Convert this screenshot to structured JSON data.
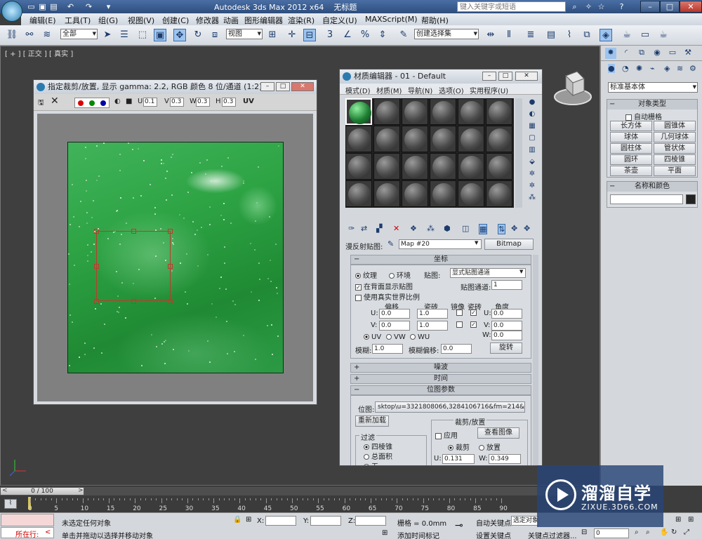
{
  "app": {
    "title": "Autodesk 3ds Max  2012 x64",
    "doc_title": "无标题",
    "search_placeholder": "键入关键字或短语"
  },
  "menu": [
    "编辑(E)",
    "工具(T)",
    "组(G)",
    "视图(V)",
    "创建(C)",
    "修改器",
    "动画",
    "图形编辑器",
    "渲染(R)",
    "自定义(U)",
    "MAXScript(M)",
    "帮助(H)"
  ],
  "toolbar": {
    "selection_filter": "全部",
    "reference_coord": "视图",
    "named_selection": "创建选择集"
  },
  "viewport": {
    "label": "[ + ] [ 正交 ] [ 真实 ]"
  },
  "crop_window": {
    "title": "指定裁剪/放置, 显示 gamma: 2.2, RGB 颜色 8 位/通道 (1:2)",
    "u_label": "U",
    "u": "0.1",
    "v_label": "V",
    "v": "0.3",
    "w_label": "W",
    "w": "0.3",
    "h_label": "H",
    "h": "0.3",
    "uv_label": "UV"
  },
  "material_editor": {
    "title": "材质编辑器 - 01 - Default",
    "menu": [
      "模式(D)",
      "材质(M)",
      "导航(N)",
      "选项(O)",
      "实用程序(U)"
    ],
    "diffuse_label": "漫反射贴图:",
    "map_name": "Map #20",
    "map_type": "Bitmap",
    "coords_header": "坐标",
    "texture_label": "纹理",
    "environ_label": "环境",
    "mapping_label": "贴图:",
    "mapping_value": "显式贴图通道",
    "show_back": "在背面显示贴图",
    "map_channel_label": "贴图通道:",
    "map_channel": "1",
    "real_world": "使用真实世界比例",
    "offset_label": "偏移",
    "tiling_label": "瓷砖",
    "mirror_label": "镜像",
    "tile_label": "瓷砖",
    "angle_label": "角度",
    "u_label": "U:",
    "v_label": "V:",
    "w_label": "W:",
    "u_offset": "0.0",
    "v_offset": "0.0",
    "u_tiling": "1.0",
    "v_tiling": "1.0",
    "u_angle": "0.0",
    "v_angle": "0.0",
    "w_angle": "0.0",
    "uv": "UV",
    "vw": "VW",
    "wu": "WU",
    "blur_label": "模糊:",
    "blur": "1.0",
    "blur_offset_label": "模糊偏移:",
    "blur_offset": "0.0",
    "rotate_btn": "旋转",
    "noise_header": "噪波",
    "time_header": "时间",
    "bitmap_params_header": "位图参数",
    "bitmap_label": "位图:",
    "bitmap_path": "sktop\\u=3321808066,3284106716&fm=214&gp=0.jpg",
    "reload_btn": "重新加载",
    "crop_place_header": "裁剪/放置",
    "apply_label": "应用",
    "view_image_btn": "查看图像",
    "crop_label": "裁剪",
    "place_label": "放置",
    "filter_header": "过滤",
    "pyramidal": "四棱锥",
    "summed_area": "总面积",
    "none": "无",
    "crop_u_label": "U:",
    "crop_u": "0.131",
    "crop_w_label": "W:",
    "crop_w": "0.349"
  },
  "command_panel": {
    "category": "标准基本体",
    "object_type_header": "对象类型",
    "auto_grid": "自动栅格",
    "objects": [
      "长方体",
      "圆锥体",
      "球体",
      "几何球体",
      "圆柱体",
      "管状体",
      "圆环",
      "四棱锥",
      "茶壶",
      "平面"
    ],
    "name_color_header": "名称和颜色"
  },
  "timeline": {
    "frame": "0 / 100",
    "ticks": [
      "0",
      "5",
      "10",
      "15",
      "20",
      "25",
      "30",
      "35",
      "40",
      "45",
      "50",
      "55",
      "60",
      "65",
      "70",
      "75",
      "80",
      "85",
      "90"
    ]
  },
  "status": {
    "running_label": "所在行:",
    "selection": "未选定任何对象",
    "prompt": "单击并拖动以选择并移动对象",
    "x_label": "X:",
    "y_label": "Y:",
    "z_label": "Z:",
    "grid": "栅格 = 0.0mm",
    "add_time_tag": "添加时间标记",
    "auto_key": "自动关键点",
    "selected_obj": "选定对象",
    "set_key": "设置关键点",
    "key_filters": "关键点过滤器...",
    "current_frame": "0"
  },
  "watermark": {
    "main": "溜溜自学",
    "sub": "ZIXUE.3D66.COM"
  }
}
